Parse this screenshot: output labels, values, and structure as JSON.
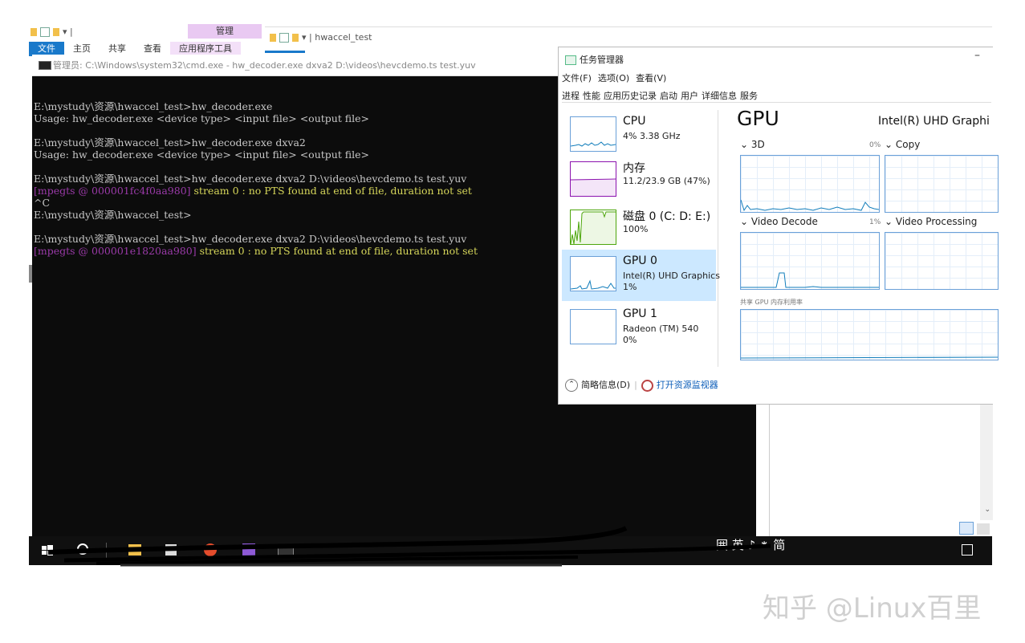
{
  "explorer_back": {
    "manage_tab": "管理",
    "tabs": [
      "文件",
      "主页",
      "共享",
      "查看",
      "应用程序工具"
    ]
  },
  "explorer_front": {
    "title": "| hwaccel_test"
  },
  "cmd": {
    "title": "管理员: C:\\Windows\\system32\\cmd.exe - hw_decoder.exe  dxva2 D:\\videos\\hevcdemo.ts test.yuv",
    "lines": [
      {
        "text": "",
        "color": "default"
      },
      {
        "text": "E:\\mystudy\\资源\\hwaccel_test>hw_decoder.exe",
        "color": "default"
      },
      {
        "text": "Usage: hw_decoder.exe <device type> <input file> <output file>",
        "color": "default"
      },
      {
        "text": "",
        "color": "default"
      },
      {
        "text": "E:\\mystudy\\资源\\hwaccel_test>hw_decoder.exe dxva2",
        "color": "default"
      },
      {
        "text": "Usage: hw_decoder.exe <device type> <input file> <output file>",
        "color": "default"
      },
      {
        "text": "",
        "color": "default"
      },
      {
        "text": "E:\\mystudy\\资源\\hwaccel_test>hw_decoder.exe dxva2 D:\\videos\\hevcdemo.ts test.yuv",
        "color": "default"
      },
      {
        "prefix": "[mpegts @ 000001fc4f0aa980] ",
        "text": "stream 0 : no PTS found at end of file, duration not set",
        "color": "warn"
      },
      {
        "text": "^C",
        "color": "default"
      },
      {
        "text": "E:\\mystudy\\资源\\hwaccel_test>",
        "color": "default"
      },
      {
        "text": "",
        "color": "default"
      },
      {
        "text": "E:\\mystudy\\资源\\hwaccel_test>hw_decoder.exe dxva2 D:\\videos\\hevcdemo.ts test.yuv",
        "color": "default"
      },
      {
        "prefix": "[mpegts @ 000001e1820aa980] ",
        "text": "stream 0 : no PTS found at end of file, duration not set",
        "color": "warn"
      }
    ]
  },
  "task_manager": {
    "title": "任务管理器",
    "minimize_glyph": "–",
    "menu": [
      "文件(F)",
      "选项(O)",
      "查看(V)"
    ],
    "tabs": [
      "进程",
      "性能",
      "应用历史记录",
      "启动",
      "用户",
      "详细信息",
      "服务"
    ],
    "sidebar": [
      {
        "name": "CPU",
        "sub": [
          "4% 3.38 GHz"
        ],
        "color": "#117dbb"
      },
      {
        "name": "内存",
        "sub": [
          "11.2/23.9 GB (47%)"
        ],
        "color": "#8b12ae"
      },
      {
        "name": "磁盘 0 (C: D: E:)",
        "sub": [
          "100%"
        ],
        "color": "#4da60c"
      },
      {
        "name": "GPU 0",
        "sub": [
          "Intel(R) UHD Graphics",
          "1%"
        ],
        "color": "#117dbb"
      },
      {
        "name": "GPU 1",
        "sub": [
          "Radeon (TM) 540",
          "0%"
        ],
        "color": "#117dbb"
      }
    ],
    "selected_index": 3,
    "panel": {
      "heading": "GPU",
      "model": "Intel(R) UHD Graphi",
      "engines": [
        {
          "label": "⌄ 3D",
          "pct": "0%"
        },
        {
          "label": "⌄ Copy",
          "pct": ""
        },
        {
          "label": "⌄ Video Decode",
          "pct": "1%"
        },
        {
          "label": "⌄ Video Processing",
          "pct": ""
        }
      ],
      "shared_memory_label": "共享 GPU 内存利用率"
    },
    "footer": {
      "less_details": "简略信息(D)",
      "resource_monitor": "打开资源监视器"
    }
  },
  "taskbar": {
    "tray_text": "囲 英 ♪ ⁕ 简"
  },
  "watermark": "知乎 @Linux百里"
}
